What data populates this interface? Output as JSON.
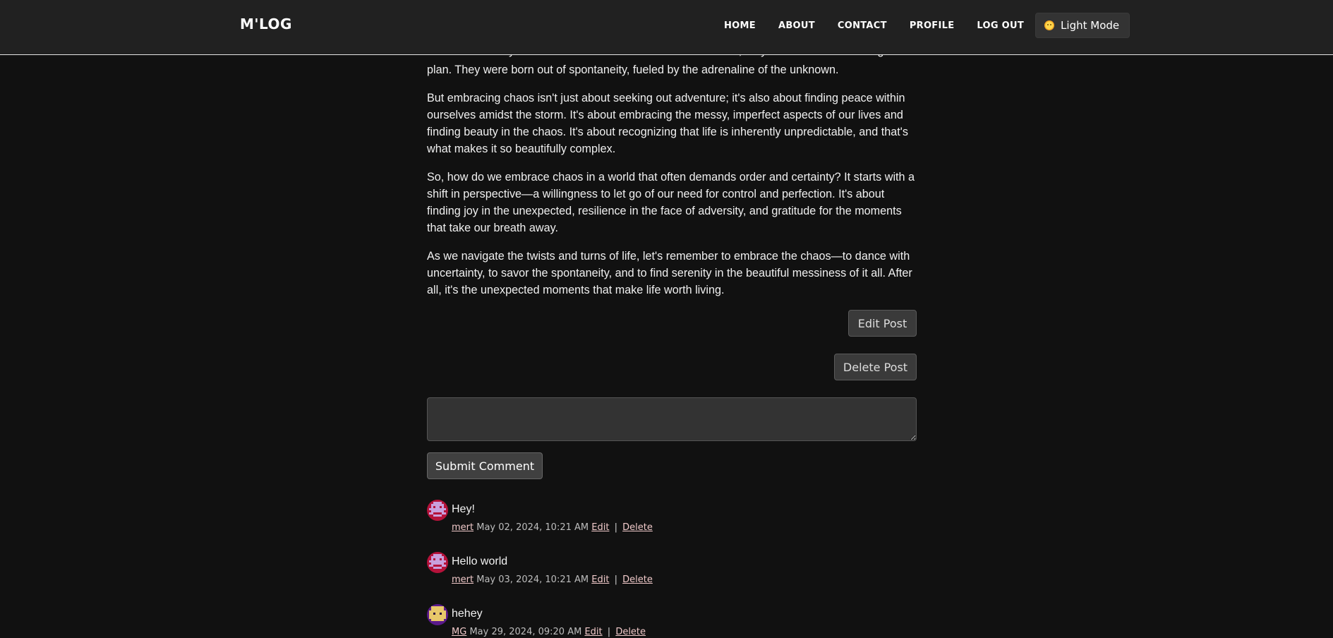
{
  "nav": {
    "brand": "M'LOG",
    "links": [
      "HOME",
      "ABOUT",
      "CONTACT",
      "PROFILE",
      "LOG OUT"
    ],
    "theme_toggle_label": "Light Mode",
    "theme_icon": "sun-face-icon"
  },
  "article": {
    "partial_line": "ones that made your heart race with excitement. Chances are, they didn't unfold according to",
    "paragraphs": [
      "plan. They were born out of spontaneity, fueled by the adrenaline of the unknown.",
      "But embracing chaos isn't just about seeking out adventure; it's also about finding peace within ourselves amidst the storm. It's about embracing the messy, imperfect aspects of our lives and finding beauty in the chaos. It's about recognizing that life is inherently unpredictable, and that's what makes it so beautifully complex.",
      "So, how do we embrace chaos in a world that often demands order and certainty? It starts with a shift in perspective—a willingness to let go of our need for control and perfection. It's about finding joy in the unexpected, resilience in the face of adversity, and gratitude for the moments that take our breath away.",
      "As we navigate the twists and turns of life, let's remember to embrace the chaos—to dance with uncertainty, to savor the spontaneity, and to find serenity in the beautiful messiness of it all. After all, it's the unexpected moments that make life worth living."
    ],
    "edit_label": "Edit Post",
    "delete_label": "Delete Post"
  },
  "comment_form": {
    "value": "",
    "placeholder": "",
    "submit_label": "Submit Comment"
  },
  "comments": [
    {
      "text": "Hey!",
      "author": "mert",
      "date": "May 02, 2024, 10:21 AM",
      "edit": "Edit",
      "sep": "|",
      "delete": "Delete",
      "avatar": "red-pixel-avatar-icon"
    },
    {
      "text": "Hello world",
      "author": "mert",
      "date": "May 03, 2024, 10:21 AM",
      "edit": "Edit",
      "sep": "|",
      "delete": "Delete",
      "avatar": "red-pixel-avatar-icon"
    },
    {
      "text": "hehey",
      "author": "MG",
      "date": "May 29, 2024, 09:20 AM",
      "edit": "Edit",
      "sep": "|",
      "delete": "Delete",
      "avatar": "purple-pixel-avatar-icon"
    }
  ],
  "colors": {
    "background": "#111111",
    "navbar": "#212121",
    "button": "#3a3a3a",
    "link": "#f0c9c9"
  }
}
